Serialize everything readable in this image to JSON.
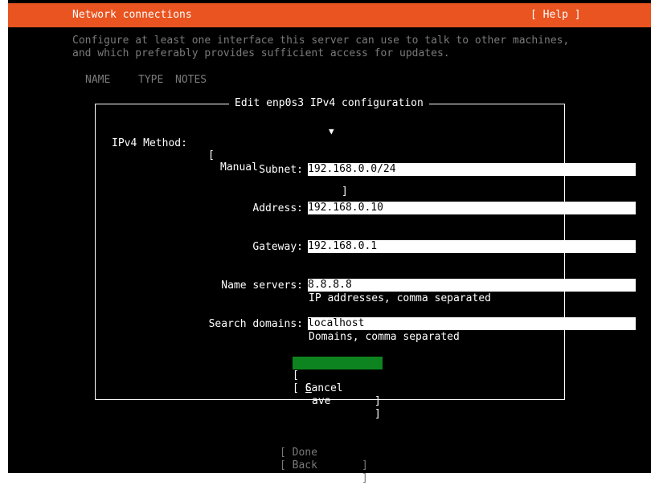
{
  "header": {
    "title": "Network connections",
    "help_label": "[ Help ]",
    "accent_color": "#e95420"
  },
  "description": {
    "line1": "Configure at least one interface this server can use to talk to other machines,",
    "line2": "and which preferably provides sufficient access for updates."
  },
  "table_headers": [
    "NAME",
    "TYPE",
    "NOTES"
  ],
  "dialog": {
    "title": "Edit enp0s3 IPv4 configuration",
    "method": {
      "label": "IPv4 Method:",
      "open_bracket": "[",
      "value": "Manual",
      "arrow": "▼",
      "close_bracket": "]"
    },
    "fields": {
      "subnet": {
        "label": "Subnet:",
        "value": "192.168.0.0/24"
      },
      "address": {
        "label": "Address:",
        "value": "192.168.0.10"
      },
      "gateway": {
        "label": "Gateway:",
        "value": "192.168.0.1"
      },
      "name_servers": {
        "label": "Name servers:",
        "value": "8.8.8.8",
        "hint": "IP addresses, comma separated"
      },
      "search_domains": {
        "label": "Search domains:",
        "value": "localhost",
        "hint": "Domains, comma separated"
      }
    },
    "buttons": {
      "save": {
        "open": "[ ",
        "hotkey": "S",
        "rest": "ave",
        "close": "]"
      },
      "cancel": {
        "label": "[ Cancel",
        "close": "]"
      }
    }
  },
  "footer": {
    "done": {
      "label": "[ Done",
      "close": "]"
    },
    "back": {
      "label": "[ Back",
      "close": "]"
    }
  }
}
